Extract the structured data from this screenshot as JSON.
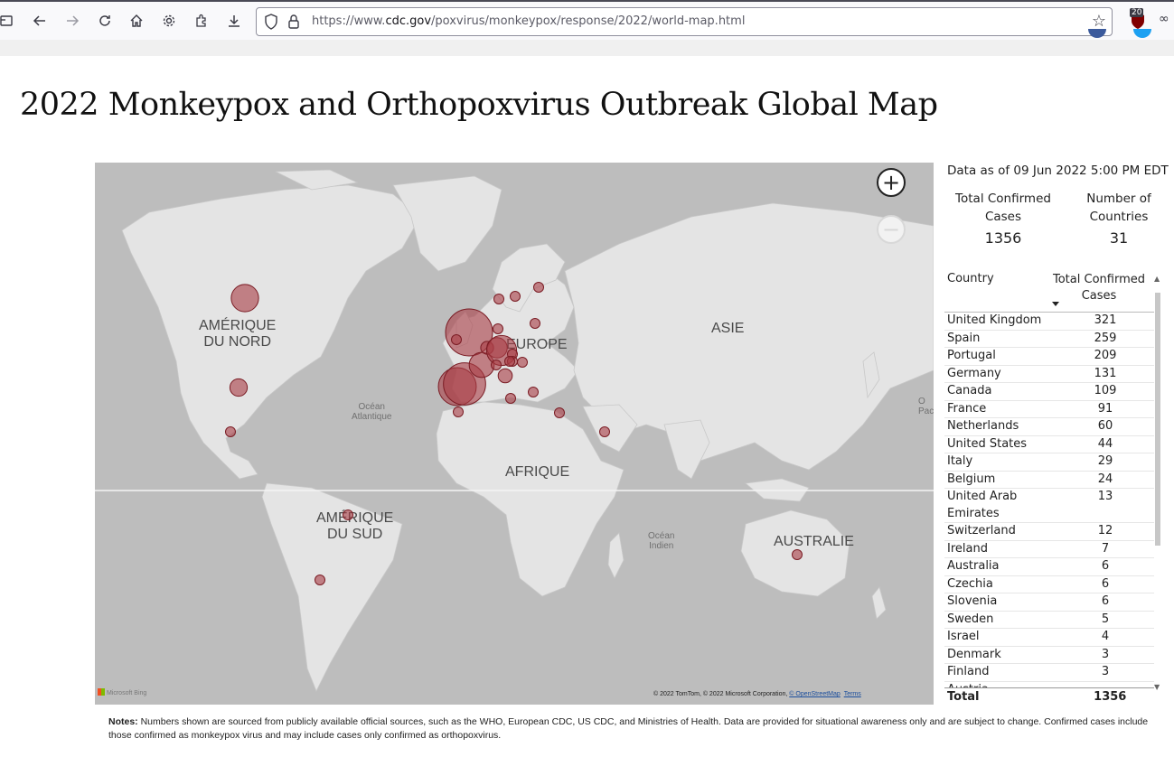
{
  "browser": {
    "url_prefix": "https://www.",
    "url_domain": "cdc.gov",
    "url_path": "/poxvirus/monkeypox/response/2022/world-map.html",
    "extension_badge": "20"
  },
  "page": {
    "title": "2022 Monkeypox and Orthopoxvirus Outbreak Global Map"
  },
  "map": {
    "labels": {
      "north_america": "AMÉRIQUE\nDU NORD",
      "south_america": "AMÉRIQUE\nDU SUD",
      "europe": "EUROPE",
      "asia": "ASIE",
      "africa": "AFRIQUE",
      "australia": "AUSTRALIE",
      "atlantic": "Océan\nAtlantique",
      "indian": "Océan\nIndien",
      "pacific_partial": "O\nPac"
    },
    "zoom_in": "+",
    "zoom_out": "−",
    "bing_label": "Microsoft Bing",
    "attribution_text": "© 2022 TomTom, © 2022 Microsoft Corporation,",
    "attribution_osm": "© OpenStreetMap",
    "attribution_terms": "Terms",
    "bubble_color": "#a83c44"
  },
  "panel": {
    "as_of": "Data as of 09 Jun 2022 5:00 PM EDT",
    "kpi_cases_label": "Total Confirmed\nCases",
    "kpi_cases_value": "1356",
    "kpi_countries_label": "Number of\nCountries",
    "kpi_countries_value": "31",
    "col_country": "Country",
    "col_cases": "Total Confirmed\nCases",
    "rows": [
      {
        "country": "United Kingdom",
        "cases": "321"
      },
      {
        "country": "Spain",
        "cases": "259"
      },
      {
        "country": "Portugal",
        "cases": "209"
      },
      {
        "country": "Germany",
        "cases": "131"
      },
      {
        "country": "Canada",
        "cases": "109"
      },
      {
        "country": "France",
        "cases": "91"
      },
      {
        "country": "Netherlands",
        "cases": "60"
      },
      {
        "country": "United States",
        "cases": "44"
      },
      {
        "country": "Italy",
        "cases": "29"
      },
      {
        "country": "Belgium",
        "cases": "24"
      },
      {
        "country": "United Arab Emirates",
        "cases": "13"
      },
      {
        "country": "Switzerland",
        "cases": "12"
      },
      {
        "country": "Ireland",
        "cases": "7"
      },
      {
        "country": "Australia",
        "cases": "6"
      },
      {
        "country": "Czechia",
        "cases": "6"
      },
      {
        "country": "Slovenia",
        "cases": "6"
      },
      {
        "country": "Sweden",
        "cases": "5"
      },
      {
        "country": "Israel",
        "cases": "4"
      },
      {
        "country": "Denmark",
        "cases": "3"
      },
      {
        "country": "Finland",
        "cases": "3"
      },
      {
        "country": "Austria",
        "cases": ""
      }
    ],
    "total_label": "Total",
    "total_value": "1356"
  },
  "notes": {
    "label": "Notes:",
    "text": " Numbers shown are sourced from publicly available official sources, such as the WHO, European CDC, US CDC, and Ministries of Health. Data are provided for situational awareness only and are subject to change. Confirmed cases include those confirmed as monkeypox virus and may include cases only confirmed as orthopoxvirus."
  }
}
